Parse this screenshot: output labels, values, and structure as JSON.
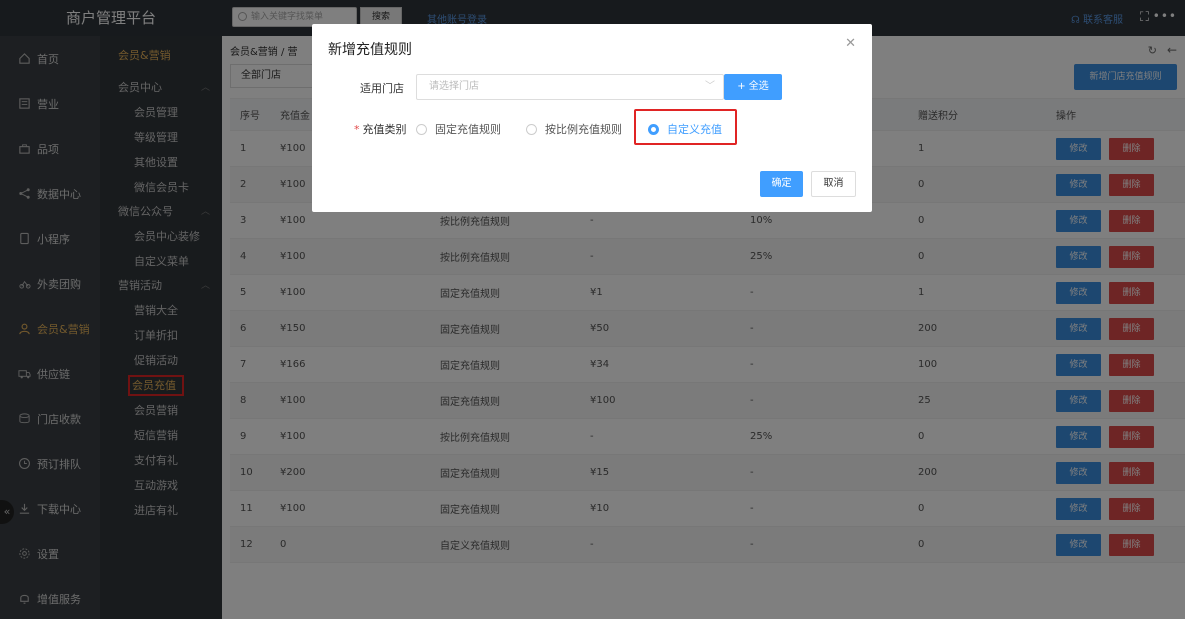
{
  "app": {
    "title": "商户管理平台"
  },
  "topbar": {
    "search_placeholder": "输入关键字找菜单",
    "search_button": "搜索",
    "other_login": "其他账号登录",
    "contact": "联系客服"
  },
  "nav": [
    {
      "label": "首页",
      "icon": "home-icon"
    },
    {
      "label": "营业",
      "icon": "business-icon"
    },
    {
      "label": "品项",
      "icon": "bag-icon"
    },
    {
      "label": "数据中心",
      "icon": "share-icon"
    },
    {
      "label": "小程序",
      "icon": "tablet-icon"
    },
    {
      "label": "外卖团购",
      "icon": "takeout-icon"
    },
    {
      "label": "会员&营销",
      "icon": "user-icon",
      "active": true
    },
    {
      "label": "供应链",
      "icon": "truck-icon"
    },
    {
      "label": "门店收款",
      "icon": "cash-icon"
    },
    {
      "label": "预订排队",
      "icon": "clock-icon"
    },
    {
      "label": "下载中心",
      "icon": "download-icon"
    },
    {
      "label": "设置",
      "icon": "settings-icon"
    },
    {
      "label": "增值服务",
      "icon": "bell-icon"
    }
  ],
  "subnav": {
    "title": "会员&营销",
    "group1": "会员中心",
    "group1_items": [
      "会员管理",
      "等级管理",
      "其他设置",
      "微信会员卡"
    ],
    "group2": "微信公众号",
    "group2_items": [
      "会员中心装修",
      "自定义菜单"
    ],
    "group3": "营销活动",
    "group3_items": [
      "营销大全",
      "订单折扣",
      "促销活动",
      "会员充值",
      "会员营销",
      "短信营销",
      "支付有礼",
      "互动游戏",
      "进店有礼"
    ]
  },
  "main": {
    "breadcrumb": "会员&营销 / 营",
    "store_filter": "全部门店",
    "add_button": "新增门店充值规则",
    "headers": [
      "序号",
      "充值金",
      "",
      "",
      "",
      "赠送积分",
      "操作"
    ],
    "rows": [
      [
        "1",
        "¥100",
        "",
        "",
        "",
        "1"
      ],
      [
        "2",
        "¥100",
        "",
        "",
        "",
        "0"
      ],
      [
        "3",
        "¥100",
        "按比例充值规则",
        "-",
        "10%",
        "0"
      ],
      [
        "4",
        "¥100",
        "按比例充值规则",
        "-",
        "25%",
        "0"
      ],
      [
        "5",
        "¥100",
        "固定充值规则",
        "¥1",
        "-",
        "1"
      ],
      [
        "6",
        "¥150",
        "固定充值规则",
        "¥50",
        "-",
        "200"
      ],
      [
        "7",
        "¥166",
        "固定充值规则",
        "¥34",
        "-",
        "100"
      ],
      [
        "8",
        "¥100",
        "固定充值规则",
        "¥100",
        "-",
        "25"
      ],
      [
        "9",
        "¥100",
        "按比例充值规则",
        "-",
        "25%",
        "0"
      ],
      [
        "10",
        "¥200",
        "固定充值规则",
        "¥15",
        "-",
        "200"
      ],
      [
        "11",
        "¥100",
        "固定充值规则",
        "¥10",
        "-",
        "0"
      ],
      [
        "12",
        "0",
        "自定义充值规则",
        "-",
        "-",
        "0"
      ]
    ],
    "edit_label": "修改",
    "delete_label": "删除"
  },
  "modal": {
    "title": "新增充值规则",
    "store_label": "适用门店",
    "store_placeholder": "请选择门店",
    "select_all": "+ 全选",
    "type_label": "充值类别",
    "type_options": [
      "固定充值规则",
      "按比例充值规则",
      "自定义充值"
    ],
    "selected_index": 2,
    "ok": "确定",
    "cancel": "取消"
  },
  "colors": {
    "primary": "#409eff",
    "danger": "#dc4a4a",
    "accent": "#e6b35a",
    "highlight": "#e02424"
  }
}
